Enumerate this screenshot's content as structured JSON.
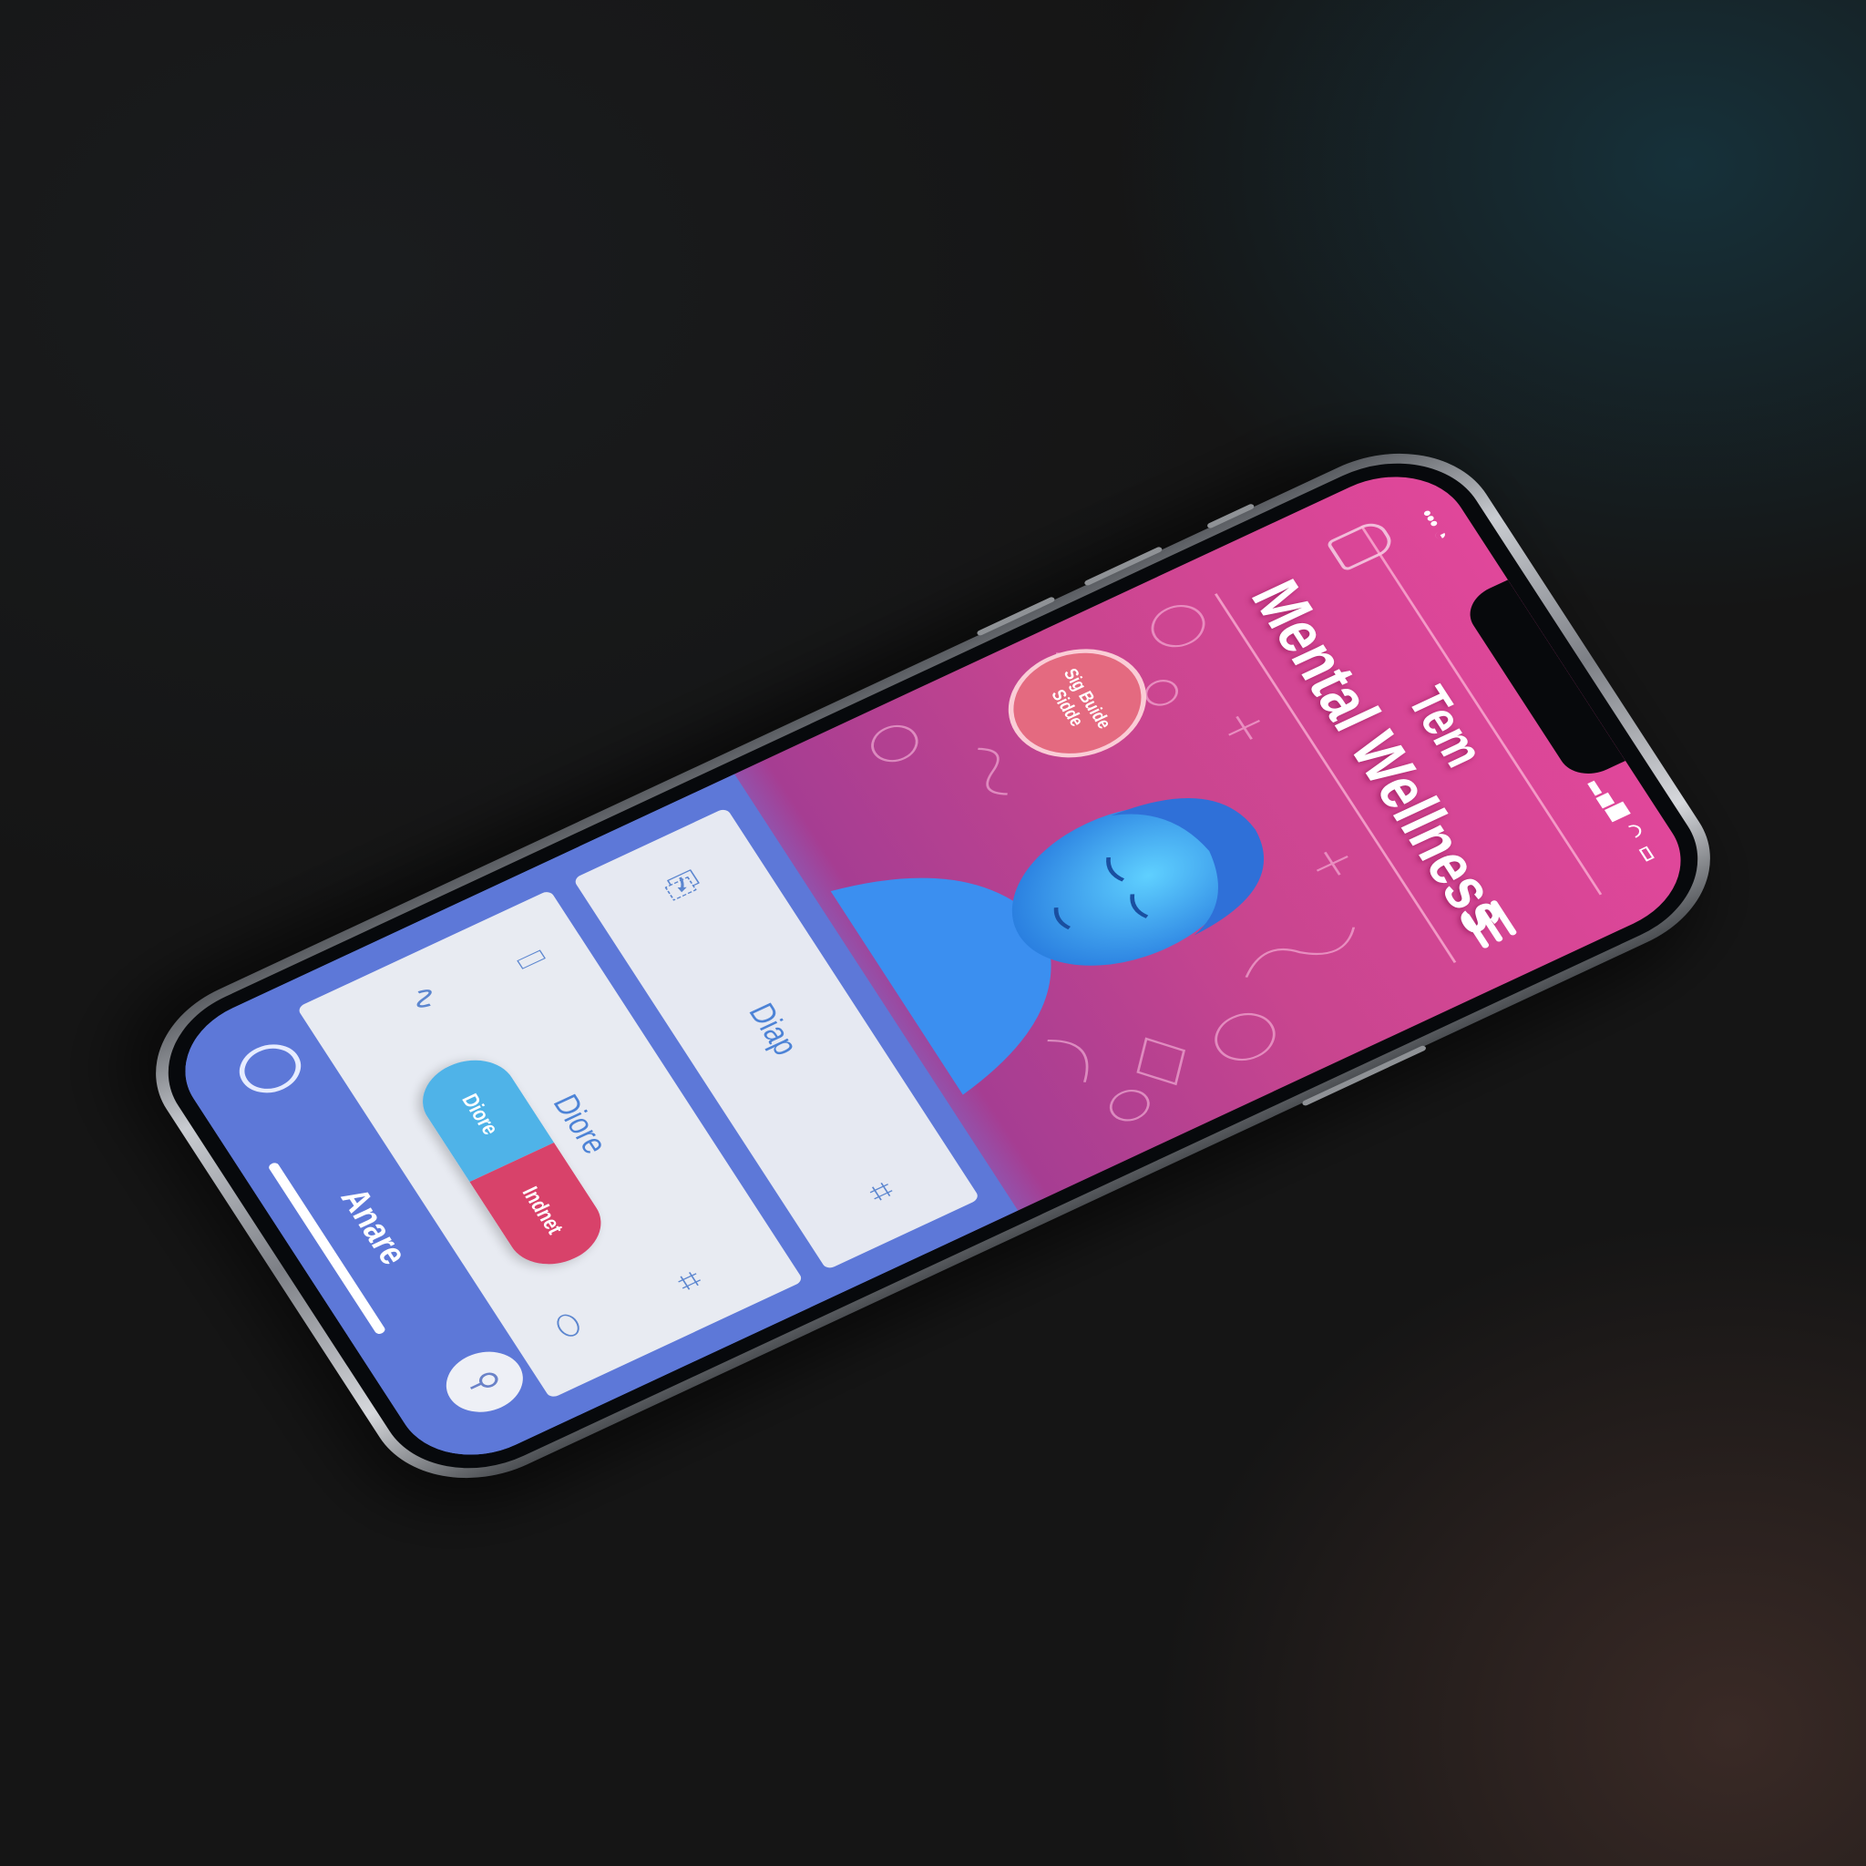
{
  "app": {
    "title_top": "Tem",
    "title_main": "Mental Wellness",
    "bubble_text": "Sig Buide Sidde",
    "card1_label": "Diap",
    "card2_label": "Diore",
    "toggle_left": "Diore",
    "toggle_right": "Indnet",
    "bottom_label": "Anare"
  },
  "icons": {
    "top_left": "lock-icon",
    "menu": "hamburger-icon",
    "card1_left": "clipboard-icon",
    "card2_left_top": "bottle-icon",
    "card2_left_bottom": "stethoscope-icon",
    "card1_right": "puzzle-icon",
    "card2_right": "puzzle-icon",
    "card2_bottom_right": "pill-icon",
    "bottom_left": "key-icon",
    "bottom_right": "key-icon"
  },
  "colors": {
    "screen_top": "#e0479a",
    "screen_bottom": "#5a78dc",
    "accent_blue": "#4fb3e8",
    "accent_red": "#d8426a"
  }
}
